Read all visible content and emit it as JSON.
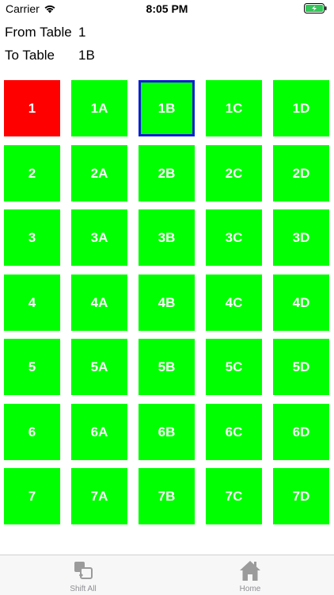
{
  "status_bar": {
    "carrier": "Carrier",
    "time": "8:05 PM"
  },
  "header": {
    "from_label": "From Table",
    "from_value": "1",
    "to_label": "To Table",
    "to_value": "1B"
  },
  "tables": {
    "rows": [
      [
        "1",
        "1A",
        "1B",
        "1C",
        "1D"
      ],
      [
        "2",
        "2A",
        "2B",
        "2C",
        "2D"
      ],
      [
        "3",
        "3A",
        "3B",
        "3C",
        "3D"
      ],
      [
        "4",
        "4A",
        "4B",
        "4C",
        "4D"
      ],
      [
        "5",
        "5A",
        "5B",
        "5C",
        "5D"
      ],
      [
        "6",
        "6A",
        "6B",
        "6C",
        "6D"
      ],
      [
        "7",
        "7A",
        "7B",
        "7C",
        "7D"
      ]
    ],
    "selected_from": "1",
    "selected_to": "1B"
  },
  "colors": {
    "available": "#00ff00",
    "source": "#ff0000",
    "target_border": "#0b1fd6"
  },
  "tab_bar": {
    "items": [
      {
        "label": "Shift All",
        "icon": "shift-all-icon"
      },
      {
        "label": "Home",
        "icon": "home-icon"
      }
    ]
  }
}
